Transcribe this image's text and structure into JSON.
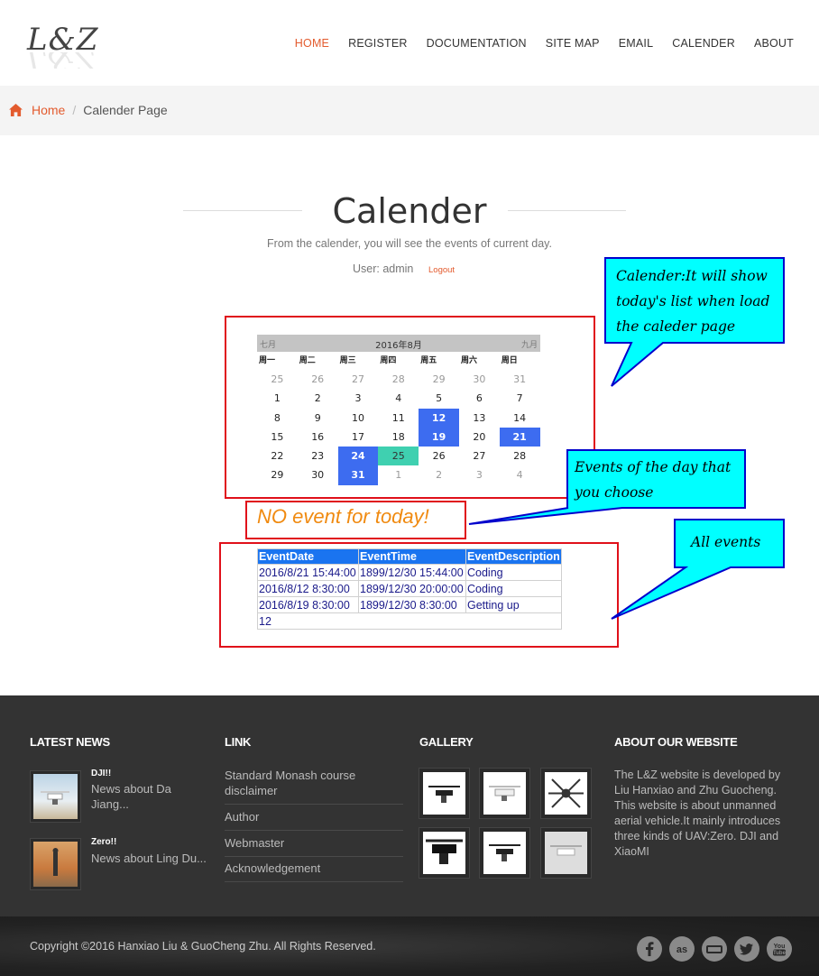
{
  "header": {
    "logo": "L&Z",
    "nav": [
      "HOME",
      "REGISTER",
      "DOCUMENTATION",
      "SITE MAP",
      "EMAIL",
      "CALENDER",
      "ABOUT"
    ]
  },
  "breadcrumb": {
    "home": "Home",
    "separator": "/",
    "current": "Calender Page"
  },
  "main": {
    "title": "Calender",
    "subtitle": "From the calender, you will see the events of current day.",
    "user_line": "User: admin",
    "logout": "Logout"
  },
  "calendar": {
    "prev": "七月",
    "title": "2016年8月",
    "next": "九月",
    "weekdays": [
      "周一",
      "周二",
      "周三",
      "周四",
      "周五",
      "周六",
      "周日"
    ],
    "weeks": [
      [
        {
          "d": "25",
          "t": "other"
        },
        {
          "d": "26",
          "t": "other"
        },
        {
          "d": "27",
          "t": "other"
        },
        {
          "d": "28",
          "t": "other"
        },
        {
          "d": "29",
          "t": "other"
        },
        {
          "d": "30",
          "t": "other"
        },
        {
          "d": "31",
          "t": "other"
        }
      ],
      [
        {
          "d": "1",
          "t": ""
        },
        {
          "d": "2",
          "t": ""
        },
        {
          "d": "3",
          "t": ""
        },
        {
          "d": "4",
          "t": ""
        },
        {
          "d": "5",
          "t": ""
        },
        {
          "d": "6",
          "t": ""
        },
        {
          "d": "7",
          "t": ""
        }
      ],
      [
        {
          "d": "8",
          "t": ""
        },
        {
          "d": "9",
          "t": ""
        },
        {
          "d": "10",
          "t": ""
        },
        {
          "d": "11",
          "t": ""
        },
        {
          "d": "12",
          "t": "ev"
        },
        {
          "d": "13",
          "t": ""
        },
        {
          "d": "14",
          "t": ""
        }
      ],
      [
        {
          "d": "15",
          "t": ""
        },
        {
          "d": "16",
          "t": ""
        },
        {
          "d": "17",
          "t": ""
        },
        {
          "d": "18",
          "t": ""
        },
        {
          "d": "19",
          "t": "ev"
        },
        {
          "d": "20",
          "t": ""
        },
        {
          "d": "21",
          "t": "ev"
        }
      ],
      [
        {
          "d": "22",
          "t": ""
        },
        {
          "d": "23",
          "t": ""
        },
        {
          "d": "24",
          "t": "ev"
        },
        {
          "d": "25",
          "t": "today"
        },
        {
          "d": "26",
          "t": ""
        },
        {
          "d": "27",
          "t": ""
        },
        {
          "d": "28",
          "t": ""
        }
      ],
      [
        {
          "d": "29",
          "t": ""
        },
        {
          "d": "30",
          "t": ""
        },
        {
          "d": "31",
          "t": "ev"
        },
        {
          "d": "1",
          "t": "other"
        },
        {
          "d": "2",
          "t": "other"
        },
        {
          "d": "3",
          "t": "other"
        },
        {
          "d": "4",
          "t": "other"
        }
      ]
    ]
  },
  "no_event": "NO event for today!",
  "events_table": {
    "headers": [
      "EventDate",
      "EventTime",
      "EventDescription"
    ],
    "rows": [
      [
        "2016/8/21 15:44:00",
        "1899/12/30 15:44:00",
        "Coding"
      ],
      [
        "2016/8/12 8:30:00",
        "1899/12/30 20:00:00",
        "Coding"
      ],
      [
        "2016/8/19 8:30:00",
        "1899/12/30 8:30:00",
        "Getting up"
      ]
    ],
    "pager": "12"
  },
  "callouts": {
    "calender": "Calender:It will show today's list when load the caleder page",
    "events_day": "Events of the day that you choose",
    "all_events": "All events"
  },
  "footer": {
    "latest_news_title": "LATEST NEWS",
    "news": [
      {
        "title": "DJI!!",
        "desc": "News about Da Jiang..."
      },
      {
        "title": "Zero!!",
        "desc": "News about Ling Du..."
      }
    ],
    "link_title": "LINK",
    "links": [
      "Standard Monash course disclaimer",
      "Author",
      "Webmaster",
      "Acknowledgement"
    ],
    "gallery_title": "GALLERY",
    "about_title": "ABOUT OUR WEBSITE",
    "about_text": "The L&Z website is developed by Liu Hanxiao and Zhu Guocheng. This website is about unmanned aerial vehicle.It mainly introduces three kinds of UAV:Zero. DJI and XiaoMI",
    "copyright": "Copyright ©2016 Hanxiao Liu & GuoCheng Zhu. All Rights Reserved.",
    "social": [
      "facebook-icon",
      "lastfm-icon",
      "myspace-icon",
      "twitter-icon",
      "youtube-icon"
    ]
  },
  "colors": {
    "accent": "#e35b2e",
    "event_day": "#3d6cf0",
    "today": "#3fd0b0",
    "callout_fill": "#00ffff",
    "callout_border": "#0000cc",
    "annotation_border": "#e0101a"
  }
}
